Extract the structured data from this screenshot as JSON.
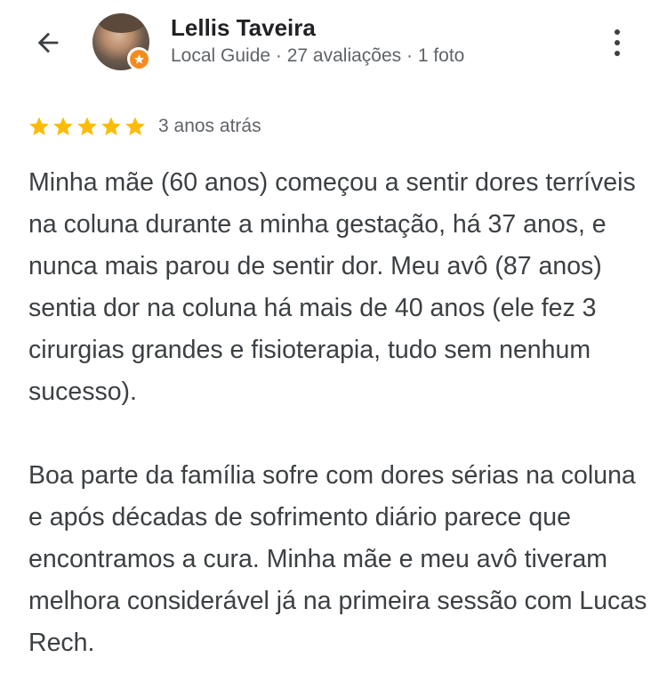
{
  "header": {
    "reviewer_name": "Lellis Taveira",
    "reviewer_meta": "Local Guide · 27 avaliações · 1 foto",
    "back_icon": "arrow-back-icon",
    "more_icon": "more-vert-icon",
    "badge_color": "#f58b1f"
  },
  "review": {
    "stars": 5,
    "star_color": "#fbbc04",
    "date": "3 anos atrás",
    "paragraphs": [
      "Minha mãe (60 anos) começou a sentir dores terríveis na coluna durante a minha gestação, há 37 anos, e nunca mais parou de sentir dor. Meu avô (87 anos) sentia dor na coluna há mais de 40 anos (ele fez 3 cirurgias grandes e fisioterapia, tudo sem nenhum sucesso).",
      "Boa parte da família sofre com dores sérias na coluna e após décadas de sofrimento diário parece que encontramos a cura. Minha mãe e meu avô tiveram melhora considerável já na primeira sessão com Lucas Rech."
    ]
  }
}
